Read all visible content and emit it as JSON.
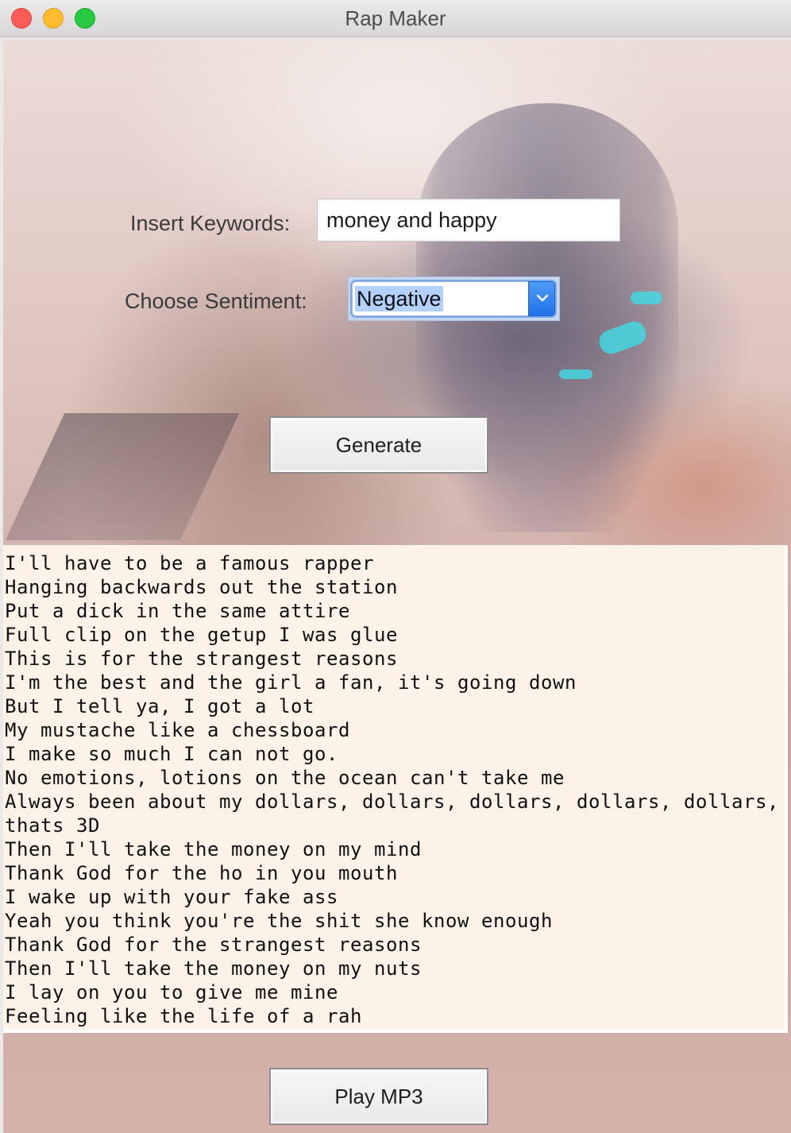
{
  "window": {
    "title": "Rap Maker"
  },
  "form": {
    "keywords_label": "Insert Keywords:",
    "keywords_value": "money and happy",
    "sentiment_label": "Choose Sentiment:",
    "sentiment_value": "Negative",
    "generate_label": "Generate"
  },
  "output": {
    "lines": [
      "I'll have to be a famous rapper",
      "Hanging backwards out the station",
      "Put a dick in the same attire",
      "Full clip on the getup I was glue",
      "This is for the strangest reasons",
      "I'm the best and the girl a fan, it's going down",
      "But I tell ya, I got a lot",
      "My mustache like a chessboard",
      "I make so much I can not go.",
      "No emotions, lotions on the ocean can't take me",
      "Always been about my dollars, dollars, dollars, dollars, dollars, thats 3D",
      "Then I'll take the money on my mind",
      "Thank God for the ho in you mouth",
      "I wake up with your fake ass",
      "Yeah you think you're the shit she know enough",
      "Thank God for the strangest reasons",
      "Then I'll take the money on my nuts",
      "I lay on you to give me mine",
      "Feeling like the life of a rah"
    ]
  },
  "player": {
    "play_label": "Play MP3"
  },
  "icons": {
    "window_close": "red-traffic-light",
    "window_minimize": "yellow-traffic-light",
    "window_zoom": "green-traffic-light",
    "select_arrow": "chevron-down-icon"
  }
}
